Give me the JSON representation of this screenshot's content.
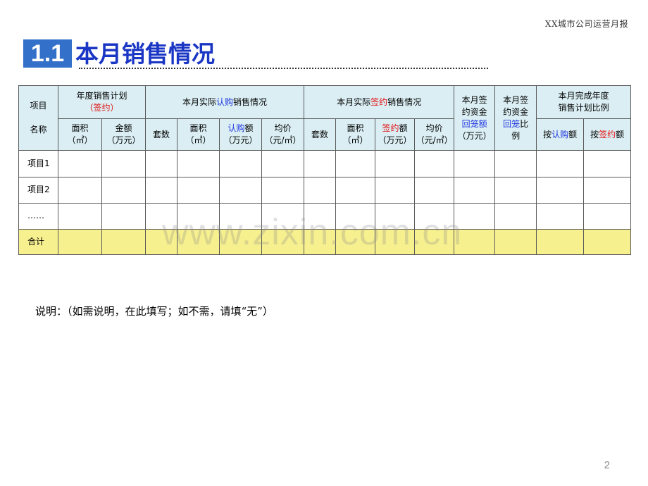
{
  "header": {
    "report_title": "XX城市公司运营月报"
  },
  "section": {
    "number": "1.1",
    "title": "本月销售情况"
  },
  "table": {
    "h_project": "项目",
    "h_project_name": "名称",
    "h_annual_plan": "年度销售计划",
    "h_annual_plan_sub": "（签约）",
    "h_sub_sign_pre": "本月实际",
    "h_sub_sign_word": "认购",
    "h_sub_sign_post": "销售情况",
    "h_sign_pre": "本月实际",
    "h_sign_word": "签约",
    "h_sign_post": "销售情况",
    "h_return_amt_1": "本月签",
    "h_return_amt_2": "约资金",
    "h_return_amt_3": "回笼额",
    "h_return_amt_4": "（万元）",
    "h_return_ratio_1": "本月签",
    "h_return_ratio_2": "约资金",
    "h_return_ratio_3a": "回笼",
    "h_return_ratio_3b": "比",
    "h_return_ratio_4": "例",
    "h_completion_1": "本月完成年度",
    "h_completion_2": "销售计划比例",
    "c_area_1": "面积",
    "c_area_2": "（㎡）",
    "c_amount_1": "金额",
    "c_amount_2": "（万元）",
    "c_units": "套数",
    "c_sub_amount_word": "认购",
    "c_sub_amount_tail": "额",
    "c_amount_unit": "（万元）",
    "c_price_1": "均价",
    "c_price_2": "（元/㎡）",
    "c_sign_amount_word": "签约",
    "c_sign_amount_tail": "额",
    "c_by": "按",
    "c_by_tail": "额",
    "rows": [
      "项目1",
      "项目2",
      "……"
    ],
    "total": "合计"
  },
  "note": "说明：（如需说明，在此填写；如不需，请填“无”）",
  "watermark": "www.zixin.com.cn",
  "page_number": "2",
  "colors": {
    "header_bg": "#daeef3",
    "total_bg": "#f7f08e",
    "accent_blue": "#3370c9",
    "title_blue": "#1a36c4",
    "red": "#e31313"
  }
}
